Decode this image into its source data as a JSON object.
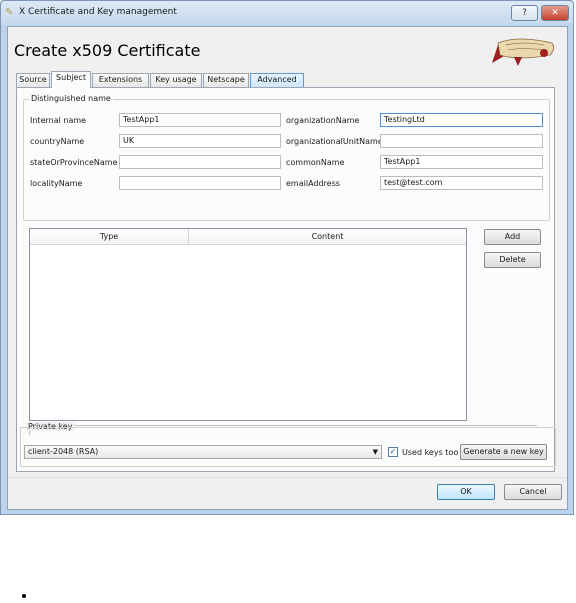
{
  "window": {
    "title": "X Certificate and Key management",
    "help_label": "?",
    "close_label": "✕",
    "app_icon": "pen-icon"
  },
  "dialog": {
    "heading": "Create x509 Certificate"
  },
  "tabs": [
    {
      "label": "Source",
      "active": false
    },
    {
      "label": "Subject",
      "active": true
    },
    {
      "label": "Extensions",
      "active": false
    },
    {
      "label": "Key usage",
      "active": false
    },
    {
      "label": "Netscape",
      "active": false
    },
    {
      "label": "Advanced",
      "active": false
    }
  ],
  "distinguished_name": {
    "group_title": "Distinguished name",
    "internal_name": {
      "label": "Internal name",
      "value": "TestApp1"
    },
    "country": {
      "label": "countryName",
      "value": "UK"
    },
    "state": {
      "label": "stateOrProvinceName",
      "value": ""
    },
    "locality": {
      "label": "localityName",
      "value": ""
    },
    "organization": {
      "label": "organizationName",
      "value": "TestingLtd"
    },
    "org_unit": {
      "label": "organizationalUnitName",
      "value": ""
    },
    "common_name": {
      "label": "commonName",
      "value": "TestApp1"
    },
    "email": {
      "label": "emailAddress",
      "value": "test@test.com"
    }
  },
  "entries_table": {
    "columns": [
      "Type",
      "Content"
    ],
    "add_label": "Add",
    "delete_label": "Delete"
  },
  "private_key": {
    "group_title": "Private key",
    "selected": "client-2048 (RSA)",
    "used_keys_label": "Used keys too",
    "used_keys_checked": true,
    "generate_label": "Generate a new key"
  },
  "footer": {
    "ok_label": "OK",
    "cancel_label": "Cancel"
  },
  "colors": {
    "accent": "#4b92d6",
    "title_bar": "#c4d8ee",
    "dialog_bg": "#f0f0f0"
  }
}
